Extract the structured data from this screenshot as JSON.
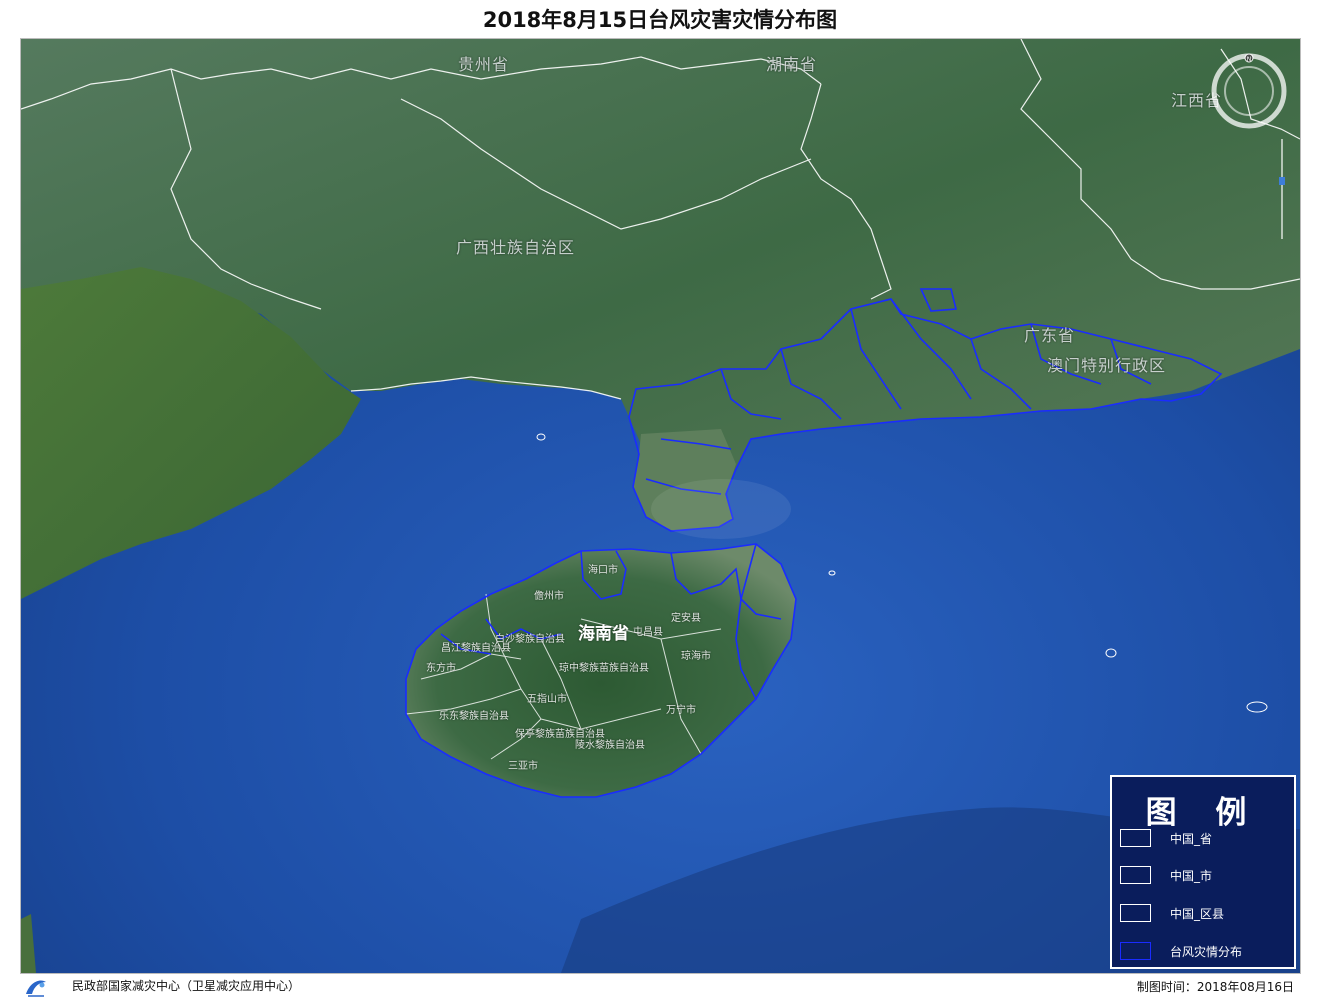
{
  "title": "2018年8月15日台风灾害灾情分布图",
  "map": {
    "labels": {
      "guizhou": "贵州省",
      "hunan": "湖南省",
      "jiangxi": "江西省",
      "guangxi": "广西壮族自治区",
      "guangdong": "广东省",
      "sar": "澳门特别行政区",
      "hainan": "海南省",
      "danzhou": "儋州市",
      "dingan": "定安县",
      "baisha": "白沙黎族自治县",
      "changjiang": "昌江黎族自治县",
      "qiongzhong": "琼中黎族苗族自治县",
      "qionghai": "琼海市",
      "dongfang": "东方市",
      "wuzhishan": "五指山市",
      "wanning": "万宁市",
      "ledong": "乐东黎族自治县",
      "baoting": "保亭黎族苗族自治县",
      "lingshui": "陵水黎族自治县",
      "sanya": "三亚市",
      "tunchang": "屯昌县",
      "haikou": "海口市"
    }
  },
  "legend": {
    "title": "图 例",
    "items": [
      {
        "label": "中国_省",
        "color": "#ffffff"
      },
      {
        "label": "中国_市",
        "color": "#ffffff"
      },
      {
        "label": "中国_区县",
        "color": "#ffffff"
      },
      {
        "label": "台风灾情分布",
        "color": "#1a2cff"
      }
    ]
  },
  "footer": {
    "agency": "民政部国家减灾中心（卫星减灾应用中心）",
    "date": "制图时间：2018年08月16日"
  },
  "colors": {
    "sea": "#1f4fa8",
    "land": "#3f6a46",
    "province_border": "#ffffff",
    "disaster_border": "#1a2cff",
    "legend_bg": "#0a1d5c"
  }
}
